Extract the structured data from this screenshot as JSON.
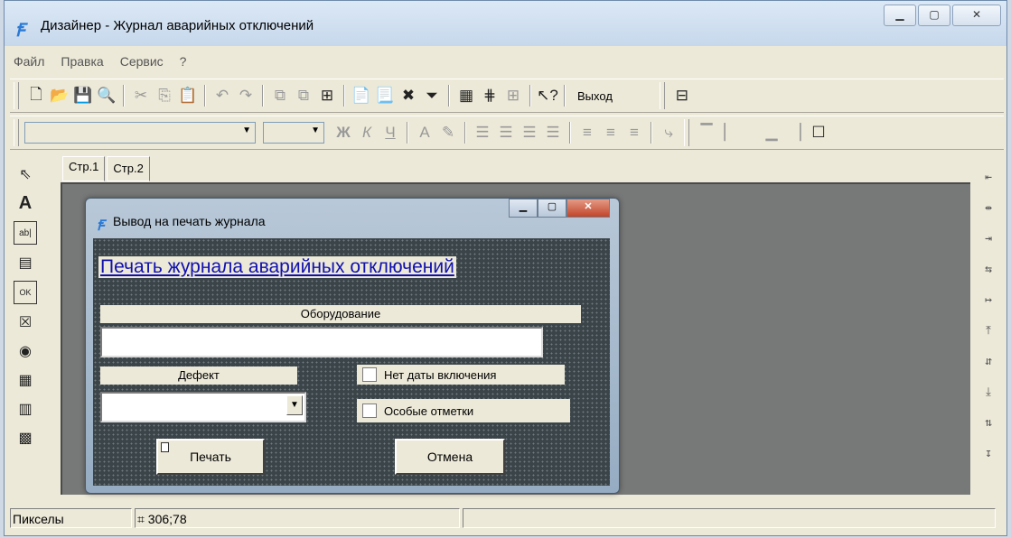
{
  "window": {
    "title": "Дизайнер - Журнал аварийных отключений",
    "app_icon": "designer-app-icon",
    "caption_buttons": [
      "minimize",
      "maximize",
      "close"
    ]
  },
  "menu": [
    "Файл",
    "Правка",
    "Сервис",
    "?"
  ],
  "toolbar1": {
    "exit_label": "Выход"
  },
  "toolbar2": {
    "font_name": "",
    "font_size": "",
    "bold": "Ж",
    "italic": "К",
    "underline": "Ч",
    "font_color": "A"
  },
  "tabs": [
    "Стр.1",
    "Стр.2"
  ],
  "dialog": {
    "title": "Вывод на печать журнала",
    "heading": "Печать журнала аварийных отключений",
    "equipment_label": "Оборудование",
    "equipment_value": "",
    "defect_label": "Дефект",
    "defect_value": "",
    "no_date_label": "Нет даты включения",
    "special_marks_label": "Особые отметки",
    "print_button": "Печать",
    "cancel_button": "Отмена"
  },
  "status": {
    "units": "Пикселы",
    "coords": "306;78"
  },
  "colors": {
    "workspace": "#777878",
    "form_background": "#3b4449",
    "link": "#1010b0"
  }
}
